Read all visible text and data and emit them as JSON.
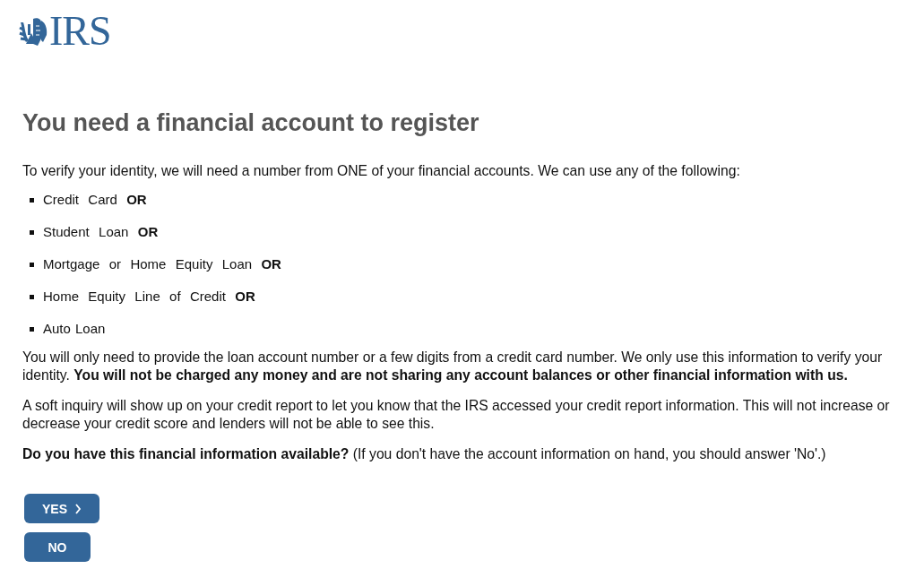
{
  "logo": {
    "text": "IRS"
  },
  "heading": "You need a financial account to register",
  "intro": "To verify your identity, we will need a number from ONE of your financial accounts. We can use any of the following:",
  "account_types": [
    {
      "text": "Credit  Card  **OR**"
    },
    {
      "text": "Student  Loan  **OR**"
    },
    {
      "text": "Mortgage  or  Home  Equity  Loan  **OR**"
    },
    {
      "text": "Home  Equity  Line  of  Credit  **OR**"
    },
    {
      "text": "Auto Loan"
    }
  ],
  "paragraphs": [
    "You will only need to provide the loan account number or a few digits from a credit card number. We only use this information to verify your identity. **You will not be charged any money and are not sharing any account balances or other financial information with us.**",
    "A soft inquiry will show up on your credit report to let you know that the IRS accessed your credit report information. This will not increase or decrease your credit score and lenders will not be able to see this.",
    "**Do you have this financial information available?**  (If you don't have the account information on hand, you should answer 'No'.)"
  ],
  "buttons": [
    {
      "label": "YES",
      "kind": "next"
    },
    {
      "label": "NO",
      "kind": "plain"
    }
  ]
}
